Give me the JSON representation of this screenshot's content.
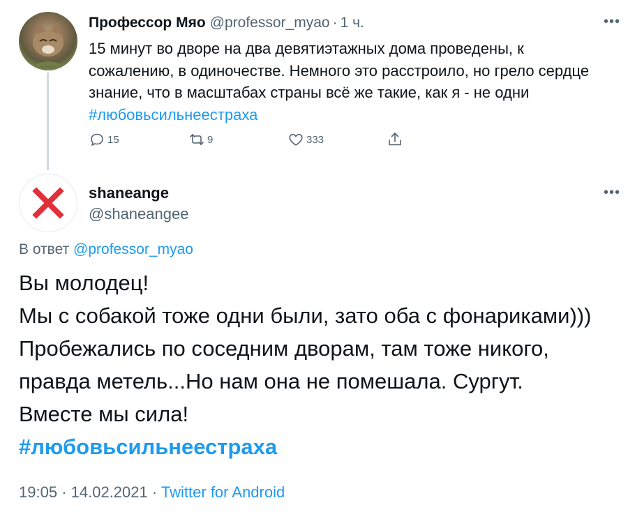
{
  "parent_tweet": {
    "author_name": "Профессор Мяо",
    "author_handle": "@professor_myao",
    "separator": "·",
    "time_ago": "1 ч.",
    "more_icon": "more-horizontal-icon",
    "text": "15 минут во дворе на два девятиэтажных дома проведены, к сожалению, в одиночестве. Немного это расстроило, но грело сердце знание, что в масштабах страны всё же такие, как я - не одни",
    "hashtag": "#любовьсильнеестраха",
    "actions": {
      "reply_count": "15",
      "retweet_count": "9",
      "like_count": "333"
    }
  },
  "reply_tweet": {
    "author_name": "shaneange",
    "author_handle": "@shaneangee",
    "avatar_icon": "red-cross-mark-icon",
    "reply_label": "В ответ",
    "reply_to_handle": "@professor_myao",
    "lines": [
      "Вы молодец!",
      "Мы с собакой тоже одни были, зато оба с фонариками)))",
      "Пробежались по соседним дворам, там тоже никого,",
      "правда метель...Но нам она не помешала. Сургут.",
      "Вместе мы сила!"
    ],
    "hashtag": "#любовьсильнеестраха",
    "time": "19:05",
    "separator": "·",
    "date": "14.02.2021",
    "source": "Twitter for Android"
  },
  "colors": {
    "accent": "#1d9bf0",
    "muted": "#536471",
    "text": "#0f1419",
    "avatar_cross": "#e0303a"
  }
}
